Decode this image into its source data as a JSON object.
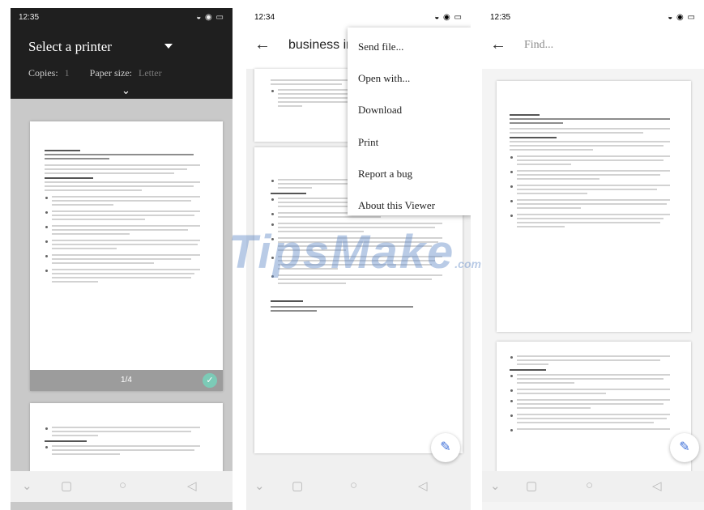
{
  "panel1": {
    "status": {
      "time": "12:35",
      "icons": "◒ ◉ ▭"
    },
    "printer_label": "Select a printer",
    "copies_label": "Copies:",
    "copies_value": "1",
    "paper_label": "Paper size:",
    "paper_value": "Letter",
    "page_count": "1/4"
  },
  "panel2": {
    "status": {
      "time": "12:34",
      "icons": "◒ ◉ ▭"
    },
    "title": "business info",
    "menu": [
      "Send file...",
      "Open with...",
      "Download",
      "Print",
      "Report a bug",
      "About this Viewer"
    ]
  },
  "panel3": {
    "status": {
      "time": "12:35",
      "icons": "◒ ◉ ▭"
    },
    "find_placeholder": "Find..."
  },
  "watermark": {
    "main": "TipsMake",
    "suffix": ".com"
  },
  "icons": {
    "back": "arrow-left-icon",
    "edit": "pencil-icon",
    "nav": [
      "chevron-down-icon",
      "square-icon",
      "circle-icon",
      "triangle-back-icon"
    ]
  },
  "colors": {
    "fab_icon": "#3d6fd8",
    "check": "#7ccbb7",
    "dark_bar": "#1f1f1f"
  }
}
